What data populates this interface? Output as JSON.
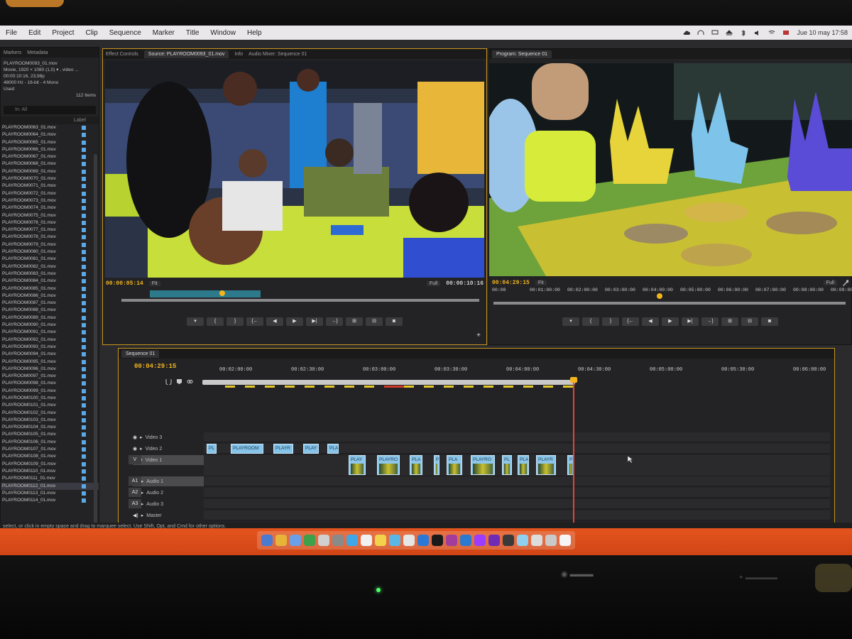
{
  "menubar": {
    "items": [
      "File",
      "Edit",
      "Project",
      "Clip",
      "Sequence",
      "Marker",
      "Title",
      "Window",
      "Help"
    ],
    "clock": "Jue 10 may  17:58"
  },
  "project_panel": {
    "tabs": [
      "Markers",
      "Metadata"
    ],
    "meta_lines": [
      "PLAYROOM0093_01.mov",
      "Movie, 1920 × 1080 (1,0) ▾ , video ...",
      "00:00:10:16, 23,98p",
      "48000 Hz - 16-bit - 4 Mono",
      "Used"
    ],
    "items_count": "112 Items",
    "search_label": "In:  All",
    "label_col": "Label",
    "files": [
      "PLAYROOM0063_01.mov",
      "PLAYROOM0064_01.mov",
      "PLAYROOM0065_01.mov",
      "PLAYROOM0066_01.mov",
      "PLAYROOM0067_01.mov",
      "PLAYROOM0068_01.mov",
      "PLAYROOM0069_01.mov",
      "PLAYROOM0070_01.mov",
      "PLAYROOM0071_01.mov",
      "PLAYROOM0072_01.mov",
      "PLAYROOM0073_01.mov",
      "PLAYROOM0074_01.mov",
      "PLAYROOM0075_01.mov",
      "PLAYROOM0076_01.mov",
      "PLAYROOM0077_01.mov",
      "PLAYROOM0078_01.mov",
      "PLAYROOM0079_01.mov",
      "PLAYROOM0080_01.mov",
      "PLAYROOM0081_01.mov",
      "PLAYROOM0082_01.mov",
      "PLAYROOM0083_01.mov",
      "PLAYROOM0084_01.mov",
      "PLAYROOM0085_01.mov",
      "PLAYROOM0086_01.mov",
      "PLAYROOM0087_01.mov",
      "PLAYROOM0088_01.mov",
      "PLAYROOM0089_01.mov",
      "PLAYROOM0090_01.mov",
      "PLAYROOM0091_01.mov",
      "PLAYROOM0092_01.mov",
      "PLAYROOM0093_01.mov",
      "PLAYROOM0094_01.mov",
      "PLAYROOM0095_01.mov",
      "PLAYROOM0096_01.mov",
      "PLAYROOM0097_01.mov",
      "PLAYROOM0098_01.mov",
      "PLAYROOM0099_01.mov",
      "PLAYROOM0100_01.mov",
      "PLAYROOM0101_01.mov",
      "PLAYROOM0102_01.mov",
      "PLAYROOM0103_01.mov",
      "PLAYROOM0104_01.mov",
      "PLAYROOM0105_01.mov",
      "PLAYROOM0106_01.mov",
      "PLAYROOM0107_01.mov",
      "PLAYROOM0108_01.mov",
      "PLAYROOM0109_01.mov",
      "PLAYROOM0110_01.mov",
      "PLAYROOM0111_01.mov",
      "PLAYROOM0112_01.mov",
      "PLAYROOM0113_01.mov",
      "PLAYROOM0114_01.mov"
    ],
    "selected_index": 49
  },
  "source": {
    "tabs": [
      "Effect Controls",
      "Source: PLAYROOM0093_01.mov",
      "Info",
      "Audio Mixer: Sequence 01"
    ],
    "timecode_in": "00:00:05:14",
    "fit": "Fit",
    "full": "Full",
    "duration": "00:00:10:16"
  },
  "program": {
    "tab": "Program: Sequence 01",
    "timecode": "00:04:29:15",
    "fit": "Fit",
    "full": "Full",
    "ruler": [
      "00:00",
      "00:01:00:00",
      "00:02:00:00",
      "00:03:00:00",
      "00:04:00:00",
      "00:05:00:00",
      "00:06:00:00",
      "00:07:00:00",
      "00:08:00:00",
      "00:09:00:00"
    ]
  },
  "timeline": {
    "tab": "Sequence 01",
    "timecode": "00:04:29:15",
    "ruler": [
      "00:02:00:00",
      "00:02:30:00",
      "00:03:00:00",
      "00:03:30:00",
      "00:04:00:00",
      "00:04:30:00",
      "00:05:00:00",
      "00:05:30:00",
      "00:06:00:00"
    ],
    "tracks": [
      "Video 3",
      "Video 2",
      "Video 1",
      "Audio 1",
      "Audio 2",
      "Audio 3",
      "Master"
    ],
    "track_ids": [
      "V",
      "A1",
      "A2",
      "A3"
    ],
    "v2_clips": [
      "PL",
      "PLAYROOM",
      "PLAYR",
      "PLAY",
      "PLA"
    ],
    "v1_clips": [
      "PLAY",
      "PLAYRO",
      "PLA",
      "P",
      "PLA",
      "PLAYRO",
      "PL",
      "PLA",
      "PLAYR",
      "P"
    ]
  },
  "statusbar": "select, or click in empty space and drag to marquee select. Use Shift, Opt, and Cmd for other options.",
  "colors": {
    "accent_orange": "#c8951e",
    "timecode": "#f3b51d",
    "clip_blue": "#86c3e8",
    "playhead": "#e0463a",
    "desktop": "#e4541d"
  }
}
